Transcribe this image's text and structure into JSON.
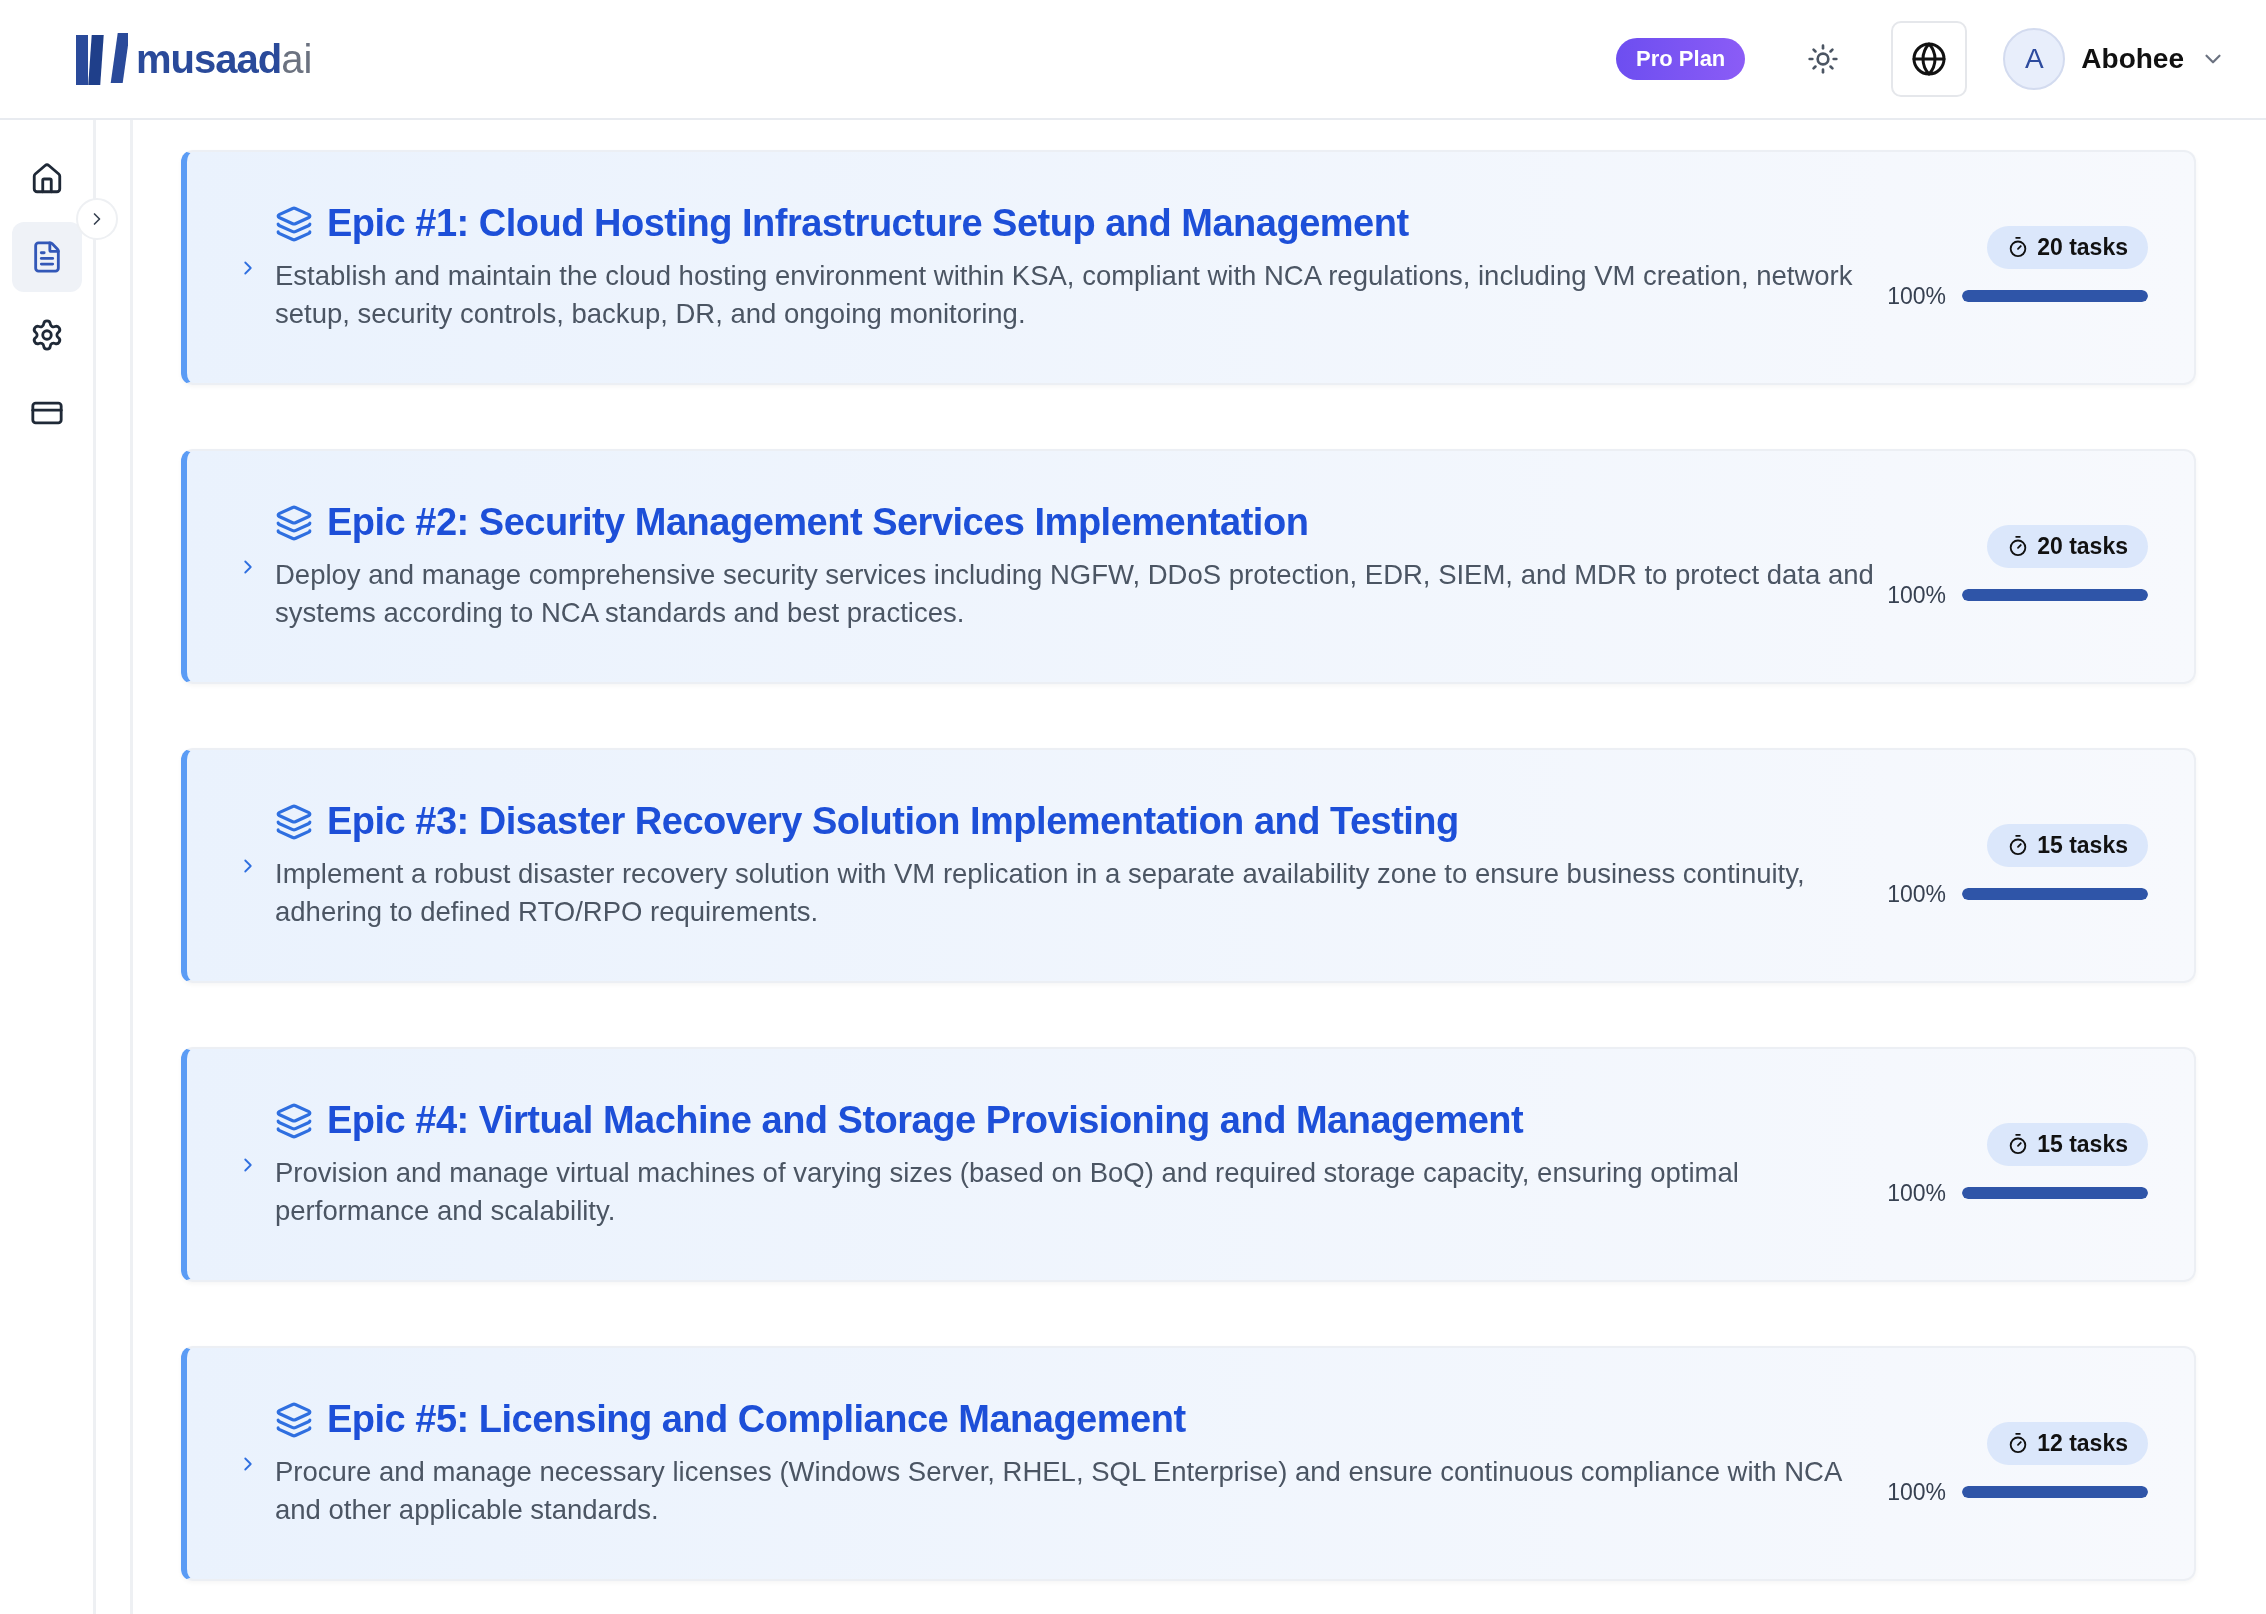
{
  "header": {
    "logo": {
      "main": "musaad",
      "suffix": "ai"
    },
    "plan_badge": "Pro Plan",
    "user": {
      "initial": "A",
      "name": "Abohee"
    }
  },
  "sidebar": {
    "items": [
      {
        "kind": "home",
        "selected": false
      },
      {
        "kind": "document",
        "selected": true
      },
      {
        "kind": "settings",
        "selected": false
      },
      {
        "kind": "billing",
        "selected": false
      }
    ]
  },
  "epics": [
    {
      "title": "Epic #1: Cloud Hosting Infrastructure Setup and Management",
      "description": "Establish and maintain the cloud hosting environment within KSA, compliant with NCA regulations, including VM creation, network setup, security controls, backup, DR, and ongoing monitoring.",
      "tasks": "20 tasks",
      "percent": "100%",
      "level": 1
    },
    {
      "title": "Epic #2: Security Management Services Implementation",
      "description": "Deploy and manage comprehensive security services including NGFW, DDoS protection, EDR, SIEM, and MDR to protect data and systems according to NCA standards and best practices.",
      "tasks": "20 tasks",
      "percent": "100%",
      "level": 1
    },
    {
      "title": "Epic #3: Disaster Recovery Solution Implementation and Testing",
      "description": "Implement a robust disaster recovery solution with VM replication in a separate availability zone to ensure business continuity, adhering to defined RTO/RPO requirements.",
      "tasks": "15 tasks",
      "percent": "100%",
      "level": 1
    },
    {
      "title": "Epic #4: Virtual Machine and Storage Provisioning and Management",
      "description": "Provision and manage virtual machines of varying sizes (based on BoQ) and required storage capacity, ensuring optimal performance and scalability.",
      "tasks": "15 tasks",
      "percent": "100%",
      "level": 1
    },
    {
      "title": "Epic #5: Licensing and Compliance Management",
      "description": "Procure and manage necessary licenses (Windows Server, RHEL, SQL Enterprise) and ensure continuous compliance with NCA and other applicable standards.",
      "tasks": "12 tasks",
      "percent": "100%",
      "level": 1
    }
  ]
}
